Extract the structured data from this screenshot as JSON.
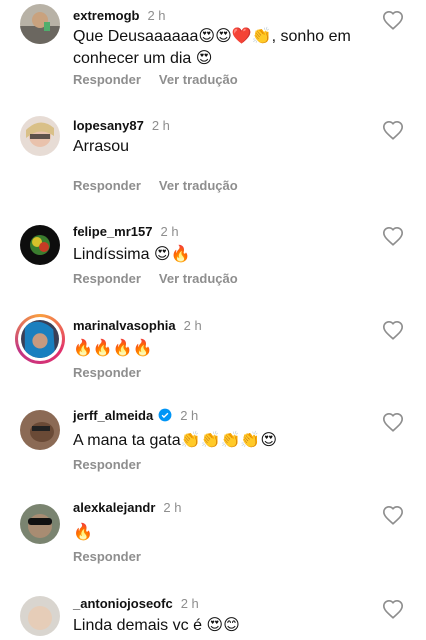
{
  "comments": [
    {
      "username": "extremogb",
      "time": "2 h",
      "text": "Que Deusaaaaaa😍😍❤️👏, sonho em conhecer um dia 😍",
      "reply": "Responder",
      "translate": "Ver tradução"
    },
    {
      "username": "lopesany87",
      "time": "2 h",
      "text": "Arrasou",
      "reply": "Responder",
      "translate": "Ver tradução"
    },
    {
      "username": "felipe_mr157",
      "time": "2 h",
      "text": "Lindíssima 😍🔥",
      "reply": "Responder",
      "translate": "Ver tradução"
    },
    {
      "username": "marinalvasophia",
      "time": "2 h",
      "text": "🔥🔥🔥🔥",
      "reply": "Responder"
    },
    {
      "username": "jerff_almeida",
      "time": "2 h",
      "text": "A mana ta gata👏👏👏👏😍",
      "reply": "Responder",
      "verified": true
    },
    {
      "username": "alexkalejandr",
      "time": "2 h",
      "text": "🔥",
      "reply": "Responder"
    },
    {
      "username": "_antoniojoseofc",
      "time": "2 h",
      "text": "Linda demais vc é 😍😊"
    }
  ],
  "icons": {
    "like": "heart-outline-icon",
    "verified": "verified-badge-icon"
  },
  "colors": {
    "muted": "#8e8e8e",
    "verified": "#0095f6"
  }
}
